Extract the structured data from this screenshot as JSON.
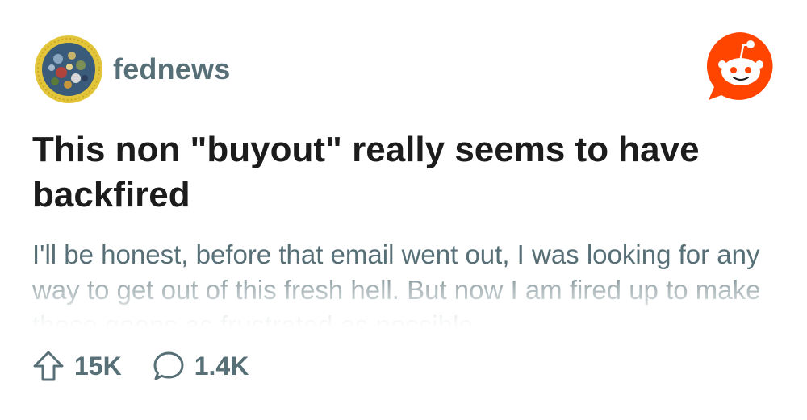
{
  "post": {
    "subreddit": "fednews",
    "title": "This non \"buyout\" really seems to have backfired",
    "body": "I'll be honest, before that email went out, I was looking for any way to get out of this fresh hell. But now I am fired up to make these goons as frustrated as possible"
  },
  "stats": {
    "upvotes": "15K",
    "comments": "1.4K"
  },
  "icons": {
    "avatar": "subreddit-avatar",
    "logo": "reddit-snoo-icon",
    "upvote": "upvote-arrow-icon",
    "comment": "comment-bubble-icon"
  },
  "colors": {
    "reddit_orange": "#ff4500",
    "secondary_text": "#576f76",
    "title_text": "#1c1c1c",
    "avatar_ring": "#e0c437"
  }
}
